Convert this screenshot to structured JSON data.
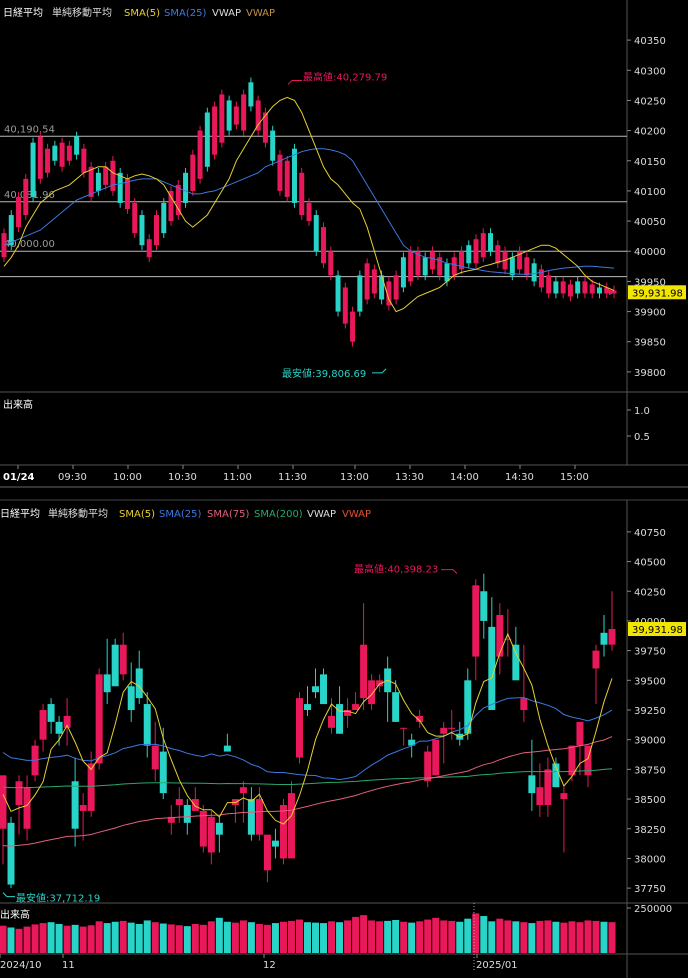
{
  "colors": {
    "up": "#e8185a",
    "down": "#28d3c8",
    "bg": "#000000",
    "grid": "#333333",
    "sma5": "#e6d030",
    "sma25": "#3c78e0",
    "sma75": "#e0607a",
    "sma200": "#2aa86e",
    "vwap_label": "#dddddd",
    "vwap2_label": "#c09040",
    "vwap_label_bottom": "#e05030",
    "price_tag": "#f2e600"
  },
  "chart_data": [
    {
      "type": "candlestick",
      "title": "日経平均",
      "legend": [
        "単純移動平均",
        "SMA(5)",
        "SMA(25)",
        "VWAP",
        "VWAP"
      ],
      "ylim": [
        39770,
        40380
      ],
      "y_ticks": [
        "40350",
        "40300",
        "40250",
        "40200",
        "40150",
        "40100",
        "40050",
        "40000",
        "39950",
        "39900",
        "39850",
        "39800"
      ],
      "x_ticks": [
        "01/24",
        "09:30",
        "10:00",
        "10:30",
        "11:00",
        "11:30",
        "13:00",
        "13:30",
        "14:00",
        "14:30",
        "15:00"
      ],
      "reference_lines": [
        {
          "label": "40,190.54",
          "value": 40190.54
        },
        {
          "label": "40,081.96",
          "value": 40081.96
        },
        {
          "label": "40,000.00",
          "value": 40000
        },
        {
          "label": "",
          "value": 39958
        }
      ],
      "high_label": "最高値:40,279.79",
      "low_label": "最安値:39,806.69",
      "last_price": "39,931.98",
      "volume_label": "出来高",
      "volume_ticks": [
        "1.0",
        "0.5"
      ],
      "sma5": [
        39975,
        39990,
        40010,
        40040,
        40060,
        40080,
        40090,
        40100,
        40105,
        40110,
        40120,
        40130,
        40135,
        40140,
        40140,
        40130,
        40125,
        40120,
        40125,
        40128,
        40125,
        40120,
        40110,
        40090,
        40070,
        40050,
        40040,
        40050,
        40060,
        40080,
        40100,
        40120,
        40150,
        40170,
        40190,
        40210,
        40225,
        40240,
        40250,
        40255,
        40250,
        40230,
        40200,
        40170,
        40140,
        40120,
        40110,
        40095,
        40080,
        40070,
        40040,
        40000,
        39960,
        39920,
        39900,
        39905,
        39915,
        39925,
        39930,
        39935,
        39940,
        39950,
        39960,
        39965,
        39968,
        39970,
        39975,
        39978,
        39982,
        39985,
        39990,
        39995,
        40000,
        40005,
        40010,
        40010,
        40005,
        39995,
        39985,
        39975,
        39960,
        39950,
        39945,
        39940,
        39935
      ],
      "sma25": [
        40010,
        40015,
        40020,
        40025,
        40030,
        40035,
        40045,
        40055,
        40065,
        40075,
        40085,
        40090,
        40095,
        40100,
        40105,
        40110,
        40112,
        40115,
        40118,
        40120,
        40120,
        40120,
        40115,
        40110,
        40105,
        40100,
        40095,
        40095,
        40098,
        40100,
        40105,
        40110,
        40115,
        40120,
        40125,
        40130,
        40140,
        40145,
        40150,
        40155,
        40160,
        40165,
        40168,
        40170,
        40170,
        40168,
        40165,
        40160,
        40150,
        40130,
        40110,
        40090,
        40070,
        40050,
        40030,
        40010,
        40000,
        39995,
        39990,
        39988,
        39985,
        39980,
        39978,
        39975,
        39972,
        39970,
        39968,
        39966,
        39965,
        39964,
        39963,
        39962,
        39962,
        39963,
        39965,
        39968,
        39970,
        39972,
        39973,
        39974,
        39975,
        39975,
        39974,
        39973,
        39972
      ],
      "volume_values": []
    },
    {
      "type": "candlestick",
      "title": "日経平均",
      "legend": [
        "単純移動平均",
        "SMA(5)",
        "SMA(25)",
        "SMA(75)",
        "SMA(200)",
        "VWAP",
        "VWAP"
      ],
      "ylim": [
        37650,
        40850
      ],
      "y_ticks": [
        "40750",
        "40500",
        "40250",
        "40000",
        "39750",
        "39500",
        "39250",
        "39000",
        "38750",
        "38500",
        "38250",
        "38000",
        "37750"
      ],
      "x_ticks": [
        "2024/10",
        "11",
        "12",
        "2025/01"
      ],
      "high_label": "最高値:40,398.23",
      "low_label": "最安値:37,712.19",
      "last_price": "39,931.98",
      "volume_label": "出来高",
      "volume_ticks": [
        "250000"
      ],
      "candles": [
        [
          38250,
          38700,
          37950,
          38700
        ],
        [
          38300,
          38350,
          37750,
          37780
        ],
        [
          38450,
          38700,
          38200,
          38650
        ],
        [
          38250,
          38700,
          38150,
          38600
        ],
        [
          38700,
          39000,
          38650,
          38950
        ],
        [
          39000,
          39300,
          38900,
          39250
        ],
        [
          39300,
          39350,
          39050,
          39150
        ],
        [
          39150,
          39200,
          38950,
          39050
        ],
        [
          39100,
          39350,
          38950,
          39200
        ],
        [
          38650,
          38850,
          38100,
          38250
        ],
        [
          38400,
          38550,
          38150,
          38450
        ],
        [
          38400,
          38900,
          38350,
          38800
        ],
        [
          38800,
          39600,
          38750,
          39550
        ],
        [
          39550,
          39850,
          39300,
          39400
        ],
        [
          39800,
          39850,
          39450,
          39450
        ],
        [
          39550,
          39900,
          39500,
          39800
        ],
        [
          39450,
          39650,
          39150,
          39250
        ],
        [
          39600,
          39750,
          39300,
          39350
        ],
        [
          39300,
          39400,
          38850,
          38950
        ],
        [
          38750,
          39150,
          38650,
          38950
        ],
        [
          38900,
          39100,
          38500,
          38550
        ],
        [
          38300,
          38450,
          38200,
          38350
        ],
        [
          38450,
          38600,
          38300,
          38500
        ],
        [
          38450,
          38500,
          38200,
          38300
        ],
        [
          38400,
          38600,
          38400,
          38500
        ],
        [
          38100,
          38450,
          38050,
          38400
        ],
        [
          38050,
          38400,
          37950,
          38350
        ],
        [
          38300,
          38350,
          38050,
          38200
        ],
        [
          38950,
          39050,
          38900,
          38900
        ],
        [
          38450,
          38500,
          38300,
          38500
        ],
        [
          38550,
          38650,
          38300,
          38600
        ],
        [
          38500,
          38600,
          38150,
          38200
        ],
        [
          38200,
          38600,
          38150,
          38500
        ],
        [
          37900,
          38200,
          37800,
          38200
        ],
        [
          38150,
          38250,
          38000,
          38100
        ],
        [
          38000,
          38500,
          37950,
          38450
        ],
        [
          38000,
          38650,
          38300,
          38550
        ],
        [
          38850,
          39400,
          38800,
          39350
        ],
        [
          39300,
          39450,
          39200,
          39250
        ],
        [
          39450,
          39600,
          39350,
          39400
        ],
        [
          39550,
          39600,
          39300,
          39300
        ],
        [
          39100,
          39350,
          39050,
          39200
        ],
        [
          39300,
          39450,
          39050,
          39050
        ],
        [
          39200,
          39350,
          39100,
          39250
        ],
        [
          39250,
          39400,
          39250,
          39300
        ],
        [
          39350,
          40150,
          39250,
          39800
        ],
        [
          39300,
          39550,
          39250,
          39500
        ],
        [
          39450,
          39550,
          39400,
          39500
        ],
        [
          39600,
          39700,
          39150,
          39400
        ],
        [
          39400,
          39500,
          39150,
          39150
        ],
        [
          39100,
          39100,
          38950,
          39100
        ],
        [
          39000,
          39050,
          38850,
          38950
        ],
        [
          39150,
          39250,
          39100,
          39200
        ],
        [
          38650,
          38950,
          38600,
          38900
        ],
        [
          38700,
          39000,
          38700,
          39000
        ],
        [
          39050,
          39150,
          38800,
          39100
        ],
        [
          39100,
          39250,
          39000,
          39100
        ],
        [
          39050,
          39150,
          38950,
          39000
        ],
        [
          39500,
          39600,
          39000,
          39050
        ],
        [
          39700,
          40350,
          39500,
          40300
        ],
        [
          40250,
          40398,
          39850,
          40000
        ],
        [
          39950,
          40200,
          39450,
          39250
        ],
        [
          39700,
          40150,
          39550,
          40050
        ],
        [
          39850,
          40100,
          39700,
          39850
        ],
        [
          39800,
          39950,
          39550,
          39500
        ],
        [
          39250,
          39800,
          39150,
          39350
        ],
        [
          38700,
          39000,
          38400,
          38550
        ],
        [
          38450,
          38800,
          38350,
          38600
        ],
        [
          38450,
          38850,
          38350,
          38750
        ],
        [
          38800,
          38850,
          38600,
          38600
        ],
        [
          38500,
          38600,
          38050,
          38550
        ],
        [
          38700,
          38950,
          38650,
          38950
        ],
        [
          38950,
          39100,
          38700,
          39150
        ],
        [
          38700,
          38950,
          38600,
          38950
        ],
        [
          39600,
          39800,
          39300,
          39750
        ],
        [
          39900,
          40050,
          39700,
          39800
        ],
        [
          39800,
          40250,
          39750,
          39932
        ]
      ],
      "volume_values": [
        0.62,
        0.58,
        0.55,
        0.6,
        0.65,
        0.68,
        0.7,
        0.66,
        0.62,
        0.64,
        0.6,
        0.63,
        0.72,
        0.68,
        0.71,
        0.73,
        0.69,
        0.66,
        0.74,
        0.7,
        0.67,
        0.65,
        0.63,
        0.61,
        0.66,
        0.64,
        0.72,
        0.8,
        0.71,
        0.69,
        0.74,
        0.7,
        0.66,
        0.64,
        0.68,
        0.71,
        0.73,
        0.76,
        0.7,
        0.69,
        0.68,
        0.72,
        0.7,
        0.74,
        0.82,
        0.86,
        0.74,
        0.72,
        0.73,
        0.75,
        0.71,
        0.69,
        0.72,
        0.76,
        0.8,
        0.74,
        0.73,
        0.71,
        0.78,
        0.9,
        0.84,
        0.72,
        0.78,
        0.74,
        0.72,
        0.7,
        0.68,
        0.73,
        0.74,
        0.71,
        0.69,
        0.72,
        0.7,
        0.74,
        0.73,
        0.71,
        0.7
      ]
    }
  ]
}
